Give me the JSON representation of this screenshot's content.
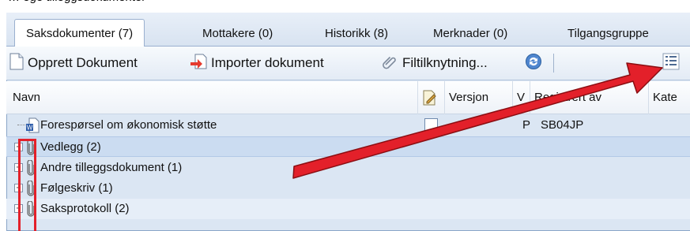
{
  "top_text": "… ege tilleggsdokumenter",
  "tabs": [
    {
      "label": "Saksdokumenter (7)",
      "active": true
    },
    {
      "label": "Mottakere (0)"
    },
    {
      "label": "Historikk (8)"
    },
    {
      "label": "Merknader (0)"
    },
    {
      "label": "Tilgangsgruppe"
    }
  ],
  "toolbar": {
    "create": "Opprett Dokument",
    "import": "Importer dokument",
    "attach": "Filtilknytning..."
  },
  "columns": {
    "name": "Navn",
    "version": "Versjon",
    "v": "V",
    "registered_by": "Registrert av",
    "category": "Kate"
  },
  "rows": [
    {
      "label": "Forespørsel om økonomisk støtte",
      "v": "P",
      "registered_by": "SB04JP"
    },
    {
      "label": "Vedlegg (2)"
    },
    {
      "label": "Andre tilleggsdokument (1)"
    },
    {
      "label": "Følgeskriv (1)"
    },
    {
      "label": "Saksprotokoll (2)"
    }
  ],
  "colors": {
    "annotation": "#e3202a",
    "selection": "#cbdcf1"
  }
}
